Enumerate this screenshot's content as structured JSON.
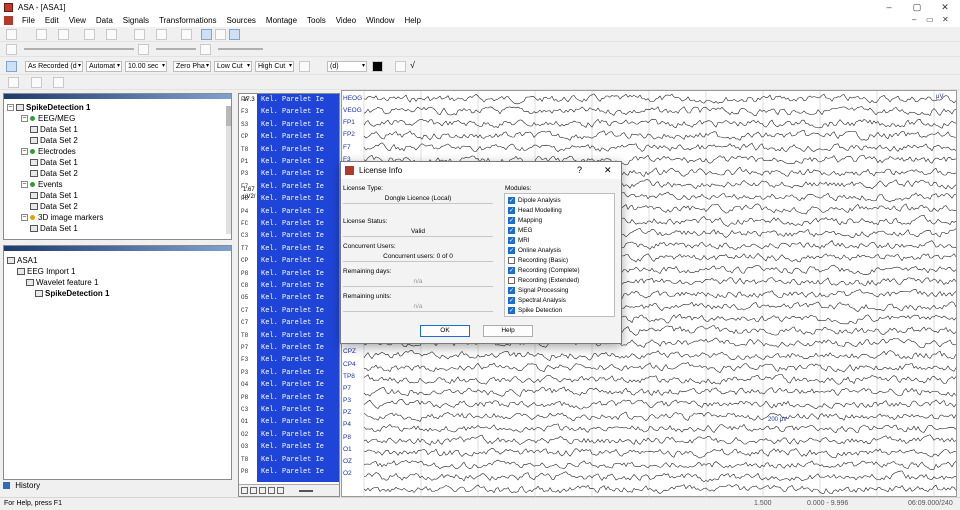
{
  "window": {
    "title": "ASA - [ASA1]",
    "controls": [
      "–",
      "▢",
      "✕"
    ],
    "mdi_controls": [
      "–",
      "▭",
      "✕"
    ]
  },
  "menu": [
    "File",
    "Edit",
    "View",
    "Data",
    "Signals",
    "Transformations",
    "Sources",
    "Montage",
    "Tools",
    "Video",
    "Window",
    "Help"
  ],
  "toolbar3": {
    "reference": "As Recorded (d",
    "scale": "Automat",
    "timebase": "10.00 sec",
    "phase": "Zero Pha",
    "lowcut": "Low Cut",
    "highcut": "High Cut",
    "montage_select": "(d)",
    "check_glyph": "√"
  },
  "tree_top": {
    "root": "SpikeDetection 1",
    "items": [
      {
        "label": "EEG/MEG",
        "level": 1,
        "toggle": "–",
        "dot": "#2f9d3a"
      },
      {
        "label": "Data Set 1",
        "level": 2
      },
      {
        "label": "Data Set 2",
        "level": 2
      },
      {
        "label": "Electrodes",
        "level": 1,
        "toggle": "–",
        "dot": "#2f9d3a"
      },
      {
        "label": "Data Set 1",
        "level": 2
      },
      {
        "label": "Data Set 2",
        "level": 2
      },
      {
        "label": "Events",
        "level": 1,
        "toggle": "–",
        "dot": "#2f9d3a"
      },
      {
        "label": "Data Set 1",
        "level": 2
      },
      {
        "label": "Data Set 2",
        "level": 2
      },
      {
        "label": "3D image markers",
        "level": 1,
        "toggle": "–",
        "dot": "#e0a400"
      },
      {
        "label": "Data Set 1",
        "level": 2
      }
    ]
  },
  "tree_bottom": {
    "root": "ASA1",
    "items": [
      {
        "label": "EEG Import 1",
        "level": 1
      },
      {
        "label": "Wavelet feature 1",
        "level": 2
      },
      {
        "label": "SpikeDetection 1",
        "level": 3,
        "bold": true
      }
    ]
  },
  "history_tab": "History",
  "wavelet": {
    "scale_top": "17.3",
    "scale_mid": "1.67",
    "scale_unit": "μV2/",
    "row_text": "Kel. Parelet Ie",
    "row_labels": [
      "FA",
      "F3",
      "S3",
      "CP",
      "T8",
      "P1",
      "P3",
      "F7",
      "F8",
      "P4",
      "FC",
      "C3",
      "T7",
      "CP",
      "P8",
      "C8",
      "O5",
      "C7",
      "C7",
      "T8",
      "P7",
      "F3",
      "P3",
      "O4",
      "P8",
      "C3",
      "O1",
      "O2",
      "O3",
      "T8",
      "P8"
    ]
  },
  "channels": [
    "HEOG",
    "VEOG",
    "FP1",
    "FP2",
    "F7",
    "F3",
    "CPZ",
    "CP4",
    "TP8",
    "P7",
    "P3",
    "PZ",
    "P4",
    "P8",
    "O1",
    "OZ",
    "O2"
  ],
  "eeg": {
    "scale_label": "200 μV",
    "corner_label": "μV"
  },
  "dialog": {
    "title": "License Info",
    "help_glyph": "?",
    "close_glyph": "✕",
    "license_type_label": "License Type:",
    "license_type_value": "Dongle Licence (Local)",
    "license_status_label": "License Status:",
    "license_status_value": "Valid",
    "concurrent_label": "Concurrent Users:",
    "concurrent_value": "Concurrent users: 0 of 0",
    "remaining_days_label": "Remaining days:",
    "remaining_days_value": "n/a",
    "remaining_units_label": "Remaining units:",
    "remaining_units_value": "n/a",
    "modules_label": "Modules:",
    "modules": [
      {
        "name": "Dipole Analysis",
        "checked": true
      },
      {
        "name": "Head Modelling",
        "checked": true
      },
      {
        "name": "Mapping",
        "checked": true
      },
      {
        "name": "MEG",
        "checked": true
      },
      {
        "name": "MRI",
        "checked": true
      },
      {
        "name": "Online Analysis",
        "checked": true
      },
      {
        "name": "Recording (Basic)",
        "checked": false
      },
      {
        "name": "Recording (Complete)",
        "checked": true
      },
      {
        "name": "Recording (Extended)",
        "checked": false
      },
      {
        "name": "Signal Processing",
        "checked": true
      },
      {
        "name": "Spectral Analysis",
        "checked": true
      },
      {
        "name": "Spike Detection",
        "checked": true
      }
    ],
    "ok_label": "OK",
    "help_label": "Help"
  },
  "status": {
    "help_text": "For Help, press F1",
    "value1": "1.500",
    "range": "0.000 - 9.996",
    "time": "06:09.000/240"
  },
  "colors": {
    "wavelet_bg": "#1f45d8",
    "channel_label": "#1a2fb6",
    "accent": "#1a6dd1"
  }
}
